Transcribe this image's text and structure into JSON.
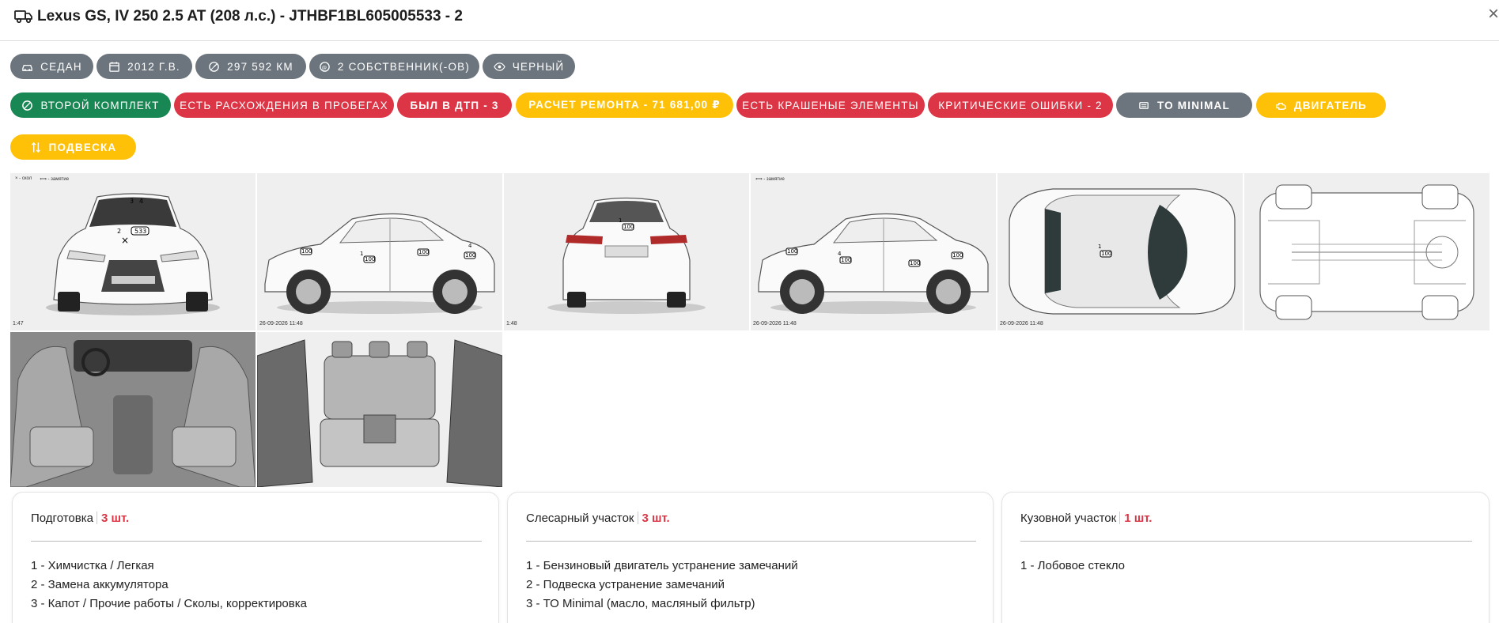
{
  "header": {
    "title": "Lexus GS, IV 250 2.5 AT (208 л.с.) - JTHBF1BL605005533 - 2",
    "close_label": "×"
  },
  "info_chips": [
    {
      "label": "Седан",
      "icon": "car-icon"
    },
    {
      "label": "2012 г.в.",
      "icon": "calendar-icon"
    },
    {
      "label": "297 592 км",
      "icon": "speedometer-icon"
    },
    {
      "label": "2 собственник(-ов)",
      "icon": "owners-icon"
    },
    {
      "label": "Черный",
      "icon": "eye-icon"
    }
  ],
  "status_chips": [
    {
      "label": "Второй комплект",
      "color": "#198754",
      "icon": "tire-icon"
    },
    {
      "label": "Есть расхождения в пробегах",
      "color": "#dc3545"
    },
    {
      "label": "Был в ДТП - 3",
      "color": "#dc3545"
    },
    {
      "label": "Расчет ремонта - 71 681,00 ₽",
      "color": "#ffc107"
    },
    {
      "label": "Есть крашеные элементы",
      "color": "#dc3545"
    },
    {
      "label": "Критические ошибки - 2",
      "color": "#dc3545"
    },
    {
      "label": "ТО Minimal",
      "color": "#6c757d",
      "icon": "oil-icon"
    },
    {
      "label": "Двигатель",
      "color": "#ffc107",
      "icon": "engine-icon"
    },
    {
      "label": "Подвеска",
      "color": "#ffc107",
      "icon": "suspension-icon"
    }
  ],
  "diagrams": [
    {
      "view": "front",
      "timestamp": "1:47",
      "legend": [
        "× - скол",
        "⟺ - замятие"
      ],
      "markers": [
        "3",
        "4",
        "2",
        "533"
      ]
    },
    {
      "view": "left-side",
      "timestamp": "26-09-2026 11:48",
      "markers": [
        "1",
        "100",
        "100",
        "100",
        "100",
        "4"
      ]
    },
    {
      "view": "rear",
      "timestamp": "1:48",
      "markers": [
        "100"
      ]
    },
    {
      "view": "right-side",
      "timestamp": "26-09-2026 11:48",
      "legend": [
        "⟺ - замятие"
      ],
      "markers": [
        "100",
        "4",
        "100",
        "100",
        "100"
      ]
    },
    {
      "view": "top",
      "timestamp": "26-09-2026 11:48",
      "markers": [
        "100"
      ]
    },
    {
      "view": "underbody",
      "timestamp": ""
    },
    {
      "view": "interior-front",
      "timestamp": ""
    },
    {
      "view": "interior-rear",
      "timestamp": ""
    }
  ],
  "cards": [
    {
      "title": "Подготовка",
      "count": "3 шт.",
      "items": [
        "1 - Химчистка / Легкая",
        "2 - Замена аккумулятора",
        "3 - Капот / Прочие работы / Сколы, корректировка"
      ]
    },
    {
      "title": "Слесарный участок",
      "count": "3 шт.",
      "items": [
        "1 - Бензиновый двигатель устранение замечаний",
        "2 - Подвеска устранение замечаний",
        "3 - ТО Minimal (масло, масляный фильтр)"
      ]
    },
    {
      "title": "Кузовной участок",
      "count": "1 шт.",
      "items": [
        "1 - Лобовое стекло"
      ]
    }
  ],
  "colors": {
    "gray": "#6c757d",
    "green": "#198754",
    "red": "#dc3545",
    "yellow": "#ffc107"
  }
}
